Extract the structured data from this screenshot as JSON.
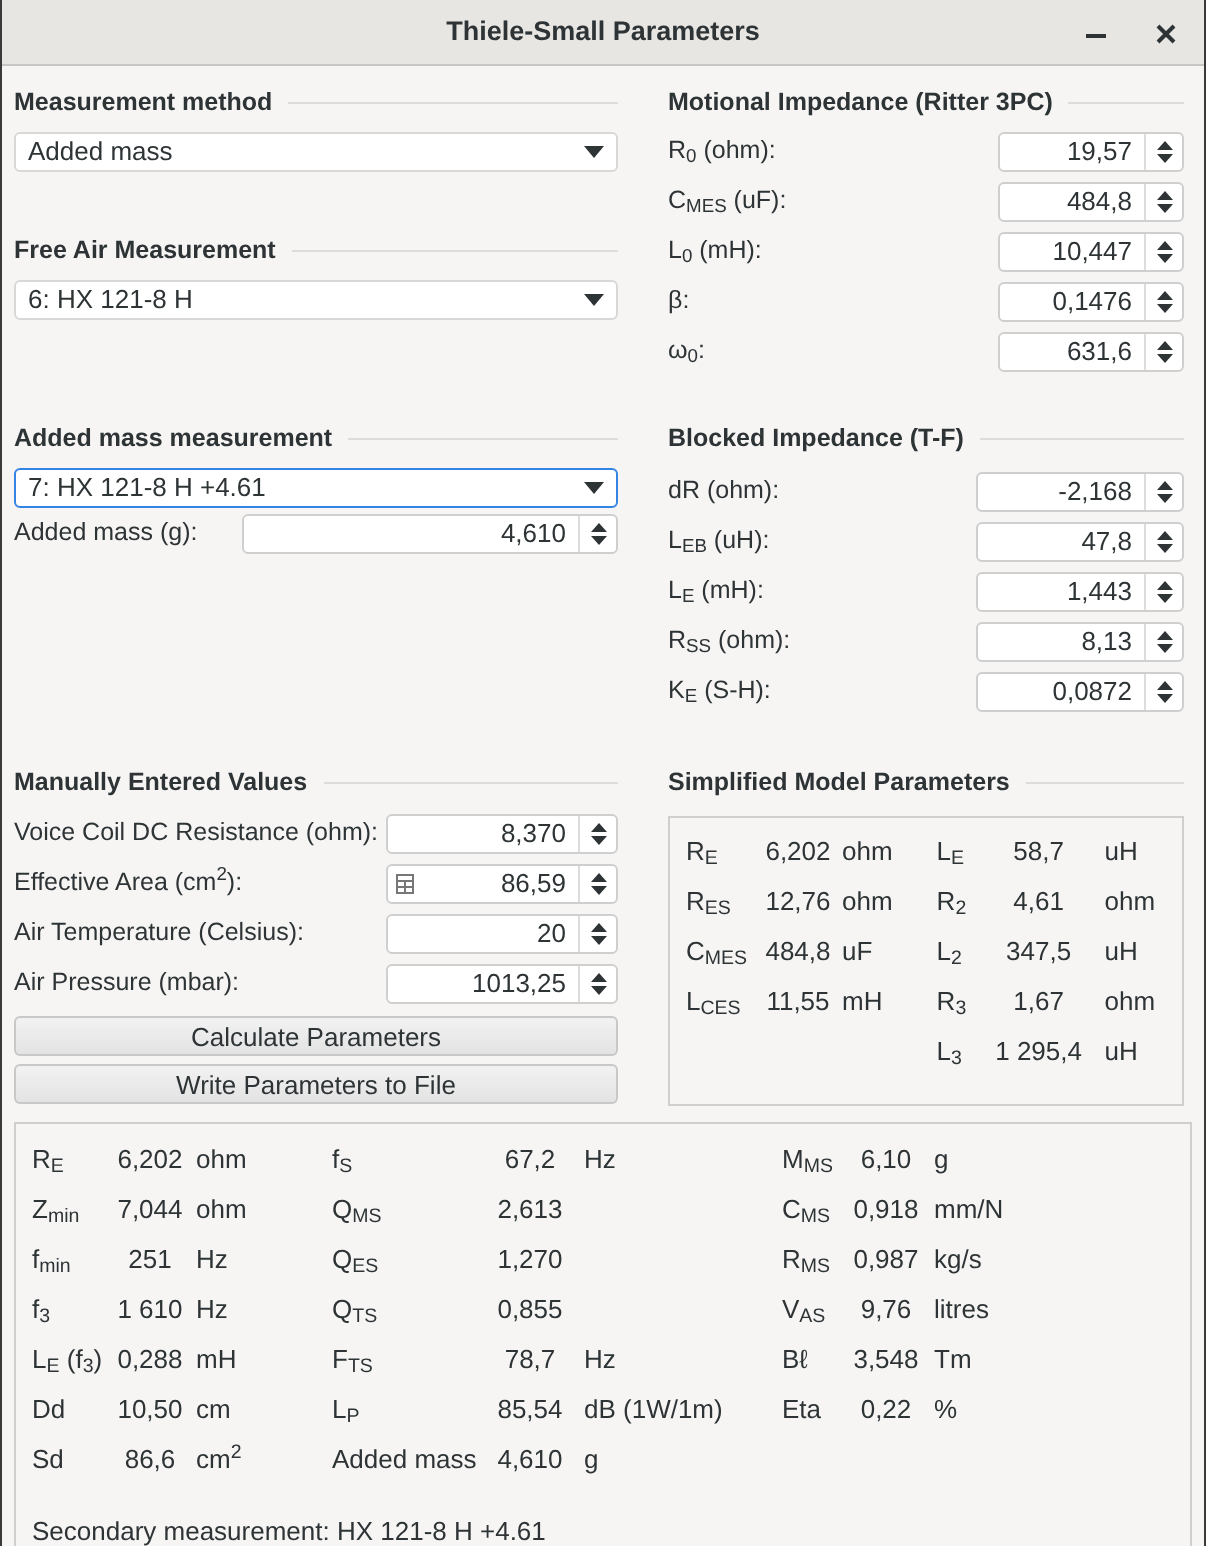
{
  "window": {
    "title": "Thiele-Small Parameters"
  },
  "measurement_method": {
    "heading": "Measurement method",
    "value": "Added mass",
    "focused": false
  },
  "free_air": {
    "heading": "Free Air Measurement",
    "value": "6: HX 121-8 H",
    "focused": false
  },
  "added_mass_measurement": {
    "heading": "Added mass measurement",
    "value": "7: HX 121-8 H +4.61",
    "focused": true,
    "fields": [
      {
        "label": "Added mass (g):",
        "value": "4,610",
        "kind": "spin"
      }
    ]
  },
  "motional_impedance": {
    "heading": "Motional Impedance (Ritter 3PC)",
    "fields": [
      {
        "label": "R$_{0}$ (ohm):",
        "value": "19,57",
        "kind": "spin"
      },
      {
        "label": "C$_{MES}$ (uF):",
        "value": "484,8",
        "kind": "spin"
      },
      {
        "label": "L$_{0}$ (mH):",
        "value": "10,447",
        "kind": "spin"
      },
      {
        "label": "β:",
        "value": "0,1476",
        "kind": "spin"
      },
      {
        "label": "ω$_{0}$:",
        "value": "631,6",
        "kind": "spin"
      }
    ]
  },
  "blocked_impedance": {
    "heading": "Blocked Impedance (T-F)",
    "fields": [
      {
        "label": "dR (ohm):",
        "value": "-2,168",
        "kind": "spin"
      },
      {
        "label": "L$_{EB}$ (uH):",
        "value": "47,8",
        "kind": "spin"
      },
      {
        "label": "L$_{E}$ (mH):",
        "value": "1,443",
        "kind": "spin"
      },
      {
        "label": "R$_{SS}$ (ohm):",
        "value": "8,13",
        "kind": "spin"
      },
      {
        "label": "K$_{E}$ (S-H):",
        "value": "0,0872",
        "kind": "spin"
      }
    ]
  },
  "manually_entered": {
    "heading": "Manually Entered Values",
    "fields": [
      {
        "label": "Voice Coil DC Resistance (ohm):",
        "value": "8,370",
        "kind": "spin"
      },
      {
        "label": "Effective Area (cm$^{2}$):",
        "value": "86,59",
        "kind": "calc"
      },
      {
        "label": "Air Temperature (Celsius):",
        "value": "20",
        "kind": "spin"
      },
      {
        "label": "Air Pressure (mbar):",
        "value": "1013,25",
        "kind": "spin"
      }
    ],
    "buttons": [
      "Calculate Parameters",
      "Write Parameters to File"
    ]
  },
  "simplified_model": {
    "heading": "Simplified Model Parameters",
    "columns": [
      [
        {
          "symbol": "R$_{E}$",
          "value": "6,202",
          "unit": "ohm"
        },
        {
          "symbol": "R$_{ES}$",
          "value": "12,76",
          "unit": "ohm"
        },
        {
          "symbol": "C$_{MES}$",
          "value": "484,8",
          "unit": "uF"
        },
        {
          "symbol": "L$_{CES}$",
          "value": "11,55",
          "unit": "mH"
        }
      ],
      [
        {
          "symbol": "L$_{E}$",
          "value": "58,7",
          "unit": "uH"
        },
        {
          "symbol": "R$_{2}$",
          "value": "4,61",
          "unit": "ohm"
        },
        {
          "symbol": "L$_{2}$",
          "value": "347,5",
          "unit": "uH"
        },
        {
          "symbol": "R$_{3}$",
          "value": "1,67",
          "unit": "ohm"
        },
        {
          "symbol": "L$_{3}$",
          "value": "1 295,4",
          "unit": "uH"
        }
      ]
    ]
  },
  "results": {
    "columns": [
      [
        {
          "symbol": "R$_{E}$",
          "value": "6,202",
          "unit": "ohm"
        },
        {
          "symbol": "Z$_{min}$",
          "value": "7,044",
          "unit": "ohm"
        },
        {
          "symbol": "f$_{min}$",
          "value": "251",
          "unit": "Hz"
        },
        {
          "symbol": "f$_{3}$",
          "value": "1 610",
          "unit": "Hz"
        },
        {
          "symbol": "L$_{E}$ (f$_{3}$)",
          "value": "0,288",
          "unit": "mH"
        },
        {
          "symbol": "Dd",
          "value": "10,50",
          "unit": "cm"
        },
        {
          "symbol": "Sd",
          "value": "86,6",
          "unit": "cm$^{2}$"
        }
      ],
      [
        {
          "symbol": "f$_{S}$",
          "value": "67,2",
          "unit": "Hz"
        },
        {
          "symbol": "Q$_{MS}$",
          "value": "2,613"
        },
        {
          "symbol": "Q$_{ES}$",
          "value": "1,270"
        },
        {
          "symbol": "Q$_{TS}$",
          "value": "0,855"
        },
        {
          "symbol": "F$_{TS}$",
          "value": "78,7",
          "unit": "Hz"
        },
        {
          "symbol": "L$_{P}$",
          "value": "85,54",
          "unit": "dB (1W/1m)"
        },
        {
          "symbol": "Added mass",
          "value": "4,610",
          "unit": "g"
        }
      ],
      [
        {
          "symbol": "M$_{MS}$",
          "value": "6,10",
          "unit": "g"
        },
        {
          "symbol": "C$_{MS}$",
          "value": "0,918",
          "unit": "mm/N"
        },
        {
          "symbol": "R$_{MS}$",
          "value": "0,987",
          "unit": "kg/s"
        },
        {
          "symbol": "V$_{AS}$",
          "value": "9,76",
          "unit": "litres"
        },
        {
          "symbol": "Bℓ",
          "value": "3,548",
          "unit": "Tm"
        },
        {
          "symbol": "Eta",
          "value": "0,22",
          "unit": "%"
        }
      ]
    ],
    "note": "Secondary measurement: HX 121-8 H +4.61"
  }
}
